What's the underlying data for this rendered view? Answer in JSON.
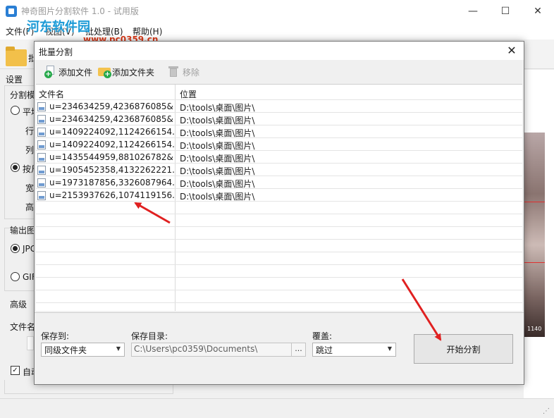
{
  "app": {
    "title": "神奇图片分割软件 1.0 - 试用版",
    "window_controls": {
      "minimize": "—",
      "maximize": "☐",
      "close": "✕"
    },
    "menu": [
      "文件(F)",
      "视图(V)",
      "批处理(B)",
      "帮助(H)"
    ],
    "toolbar_partial": "批",
    "watermark": "河东软件园",
    "watermark_url": "www.pc0359.cn"
  },
  "settings": {
    "title": "设置",
    "split_mode_partial": "分割模",
    "avg_partial": "平均",
    "rows_partial": "行",
    "cols_partial": "列",
    "by_size_partial": "按尺",
    "width_partial": "宽",
    "height_partial": "高",
    "output_partial": "输出图",
    "jpg_partial": "JPG",
    "gif_partial": "GIF",
    "advanced": "高级",
    "filename_partial": "文件名",
    "auto_partial": "自动"
  },
  "preview": {
    "caption": "1140"
  },
  "dialog": {
    "title": "批量分割",
    "close_glyph": "✕",
    "toolbar": {
      "add_file": "添加文件",
      "add_folder": "添加文件夹",
      "remove": "移除"
    },
    "table": {
      "columns": [
        "文件名",
        "位置"
      ],
      "rows": [
        {
          "name": "u=234634259,4236876085&...",
          "path": "D:\\tools\\桌面\\图片\\"
        },
        {
          "name": "u=234634259,4236876085&...",
          "path": "D:\\tools\\桌面\\图片\\"
        },
        {
          "name": "u=1409224092,1124266154...",
          "path": "D:\\tools\\桌面\\图片\\"
        },
        {
          "name": "u=1409224092,1124266154...",
          "path": "D:\\tools\\桌面\\图片\\"
        },
        {
          "name": "u=1435544959,881026782&...",
          "path": "D:\\tools\\桌面\\图片\\"
        },
        {
          "name": "u=1905452358,4132262221...",
          "path": "D:\\tools\\桌面\\图片\\"
        },
        {
          "name": "u=1973187856,3326087964...",
          "path": "D:\\tools\\桌面\\图片\\"
        },
        {
          "name": "u=2153937626,1074119156...",
          "path": "D:\\tools\\桌面\\图片\\"
        }
      ]
    },
    "save_to": {
      "label": "保存到:",
      "value": "同级文件夹"
    },
    "save_dir": {
      "label": "保存目录:",
      "value": "C:\\Users\\pc0359\\Documents\\",
      "browse": "..."
    },
    "overwrite": {
      "label": "覆盖:",
      "value": "跳过"
    },
    "start_button": "开始分割"
  },
  "colors": {
    "annotation_arrow": "#e02020",
    "accent_green": "#26a84a",
    "folder_yellow": "#f3c34f"
  }
}
